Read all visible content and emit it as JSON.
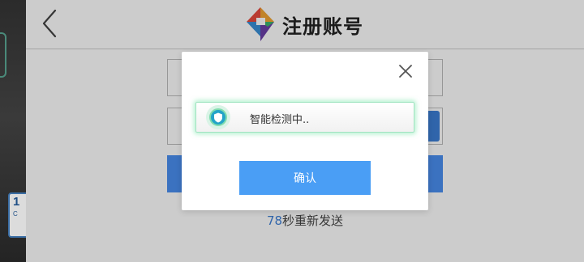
{
  "header": {
    "title": "注册账号"
  },
  "resend": {
    "countdown": "78",
    "suffix": "秒重新发送"
  },
  "dialog": {
    "status_text": "智能检测中..",
    "confirm_label": "确认"
  },
  "colors": {
    "accent": "#4a9ef5",
    "primary_button": "#4a8ff0",
    "countdown": "#3d7fd6",
    "detect_glow": "#9fe3c0",
    "shield": "#23a4c8"
  },
  "icons": {
    "back": "chevron-left-icon",
    "logo": "app-logo-icon",
    "close": "close-icon",
    "shield": "shield-icon"
  }
}
